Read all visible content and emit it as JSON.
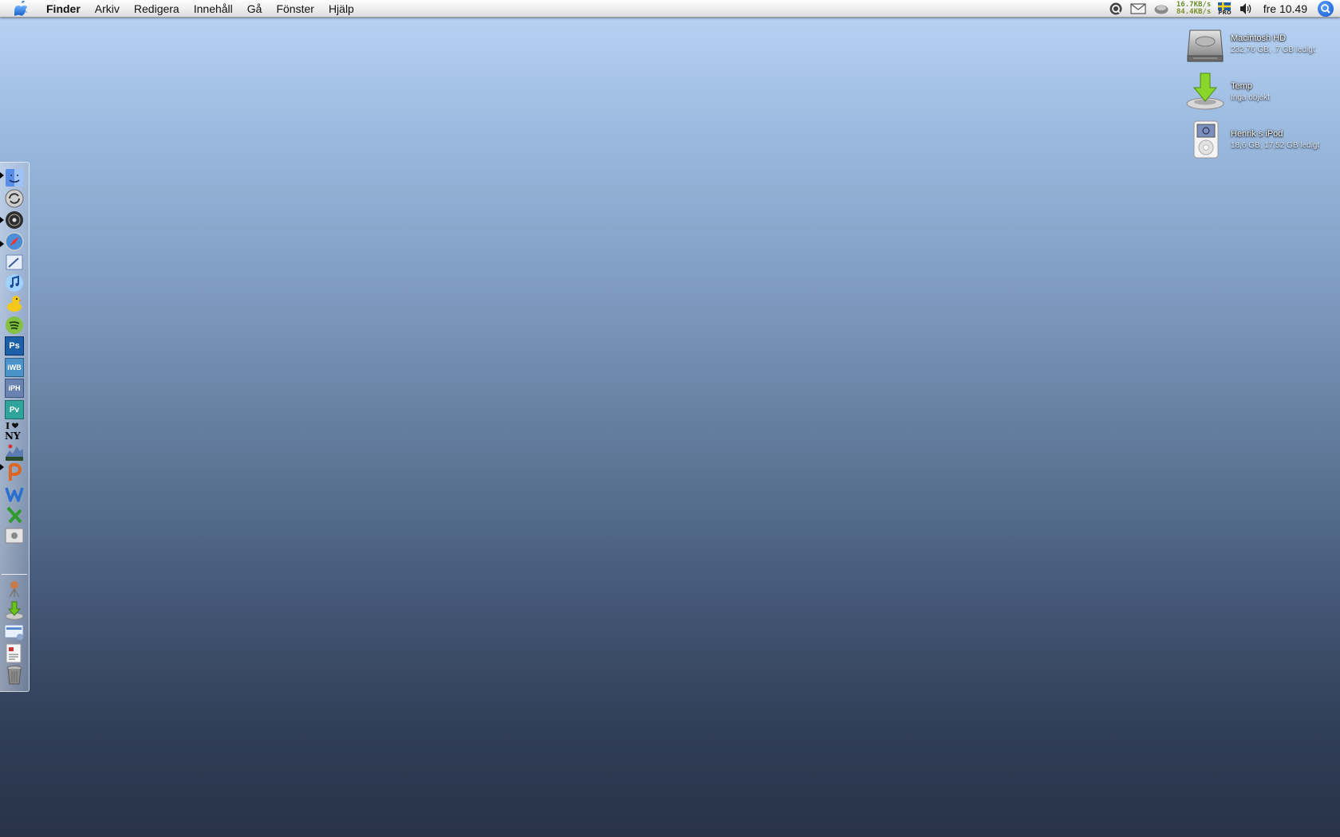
{
  "menubar": {
    "app_name": "Finder",
    "items": [
      "Arkiv",
      "Redigera",
      "Innehåll",
      "Gå",
      "Fönster",
      "Hjälp"
    ],
    "extras": {
      "net_up": "16.7KB/s",
      "net_down": "84.4KB/s",
      "flag_badge": "PRO",
      "clock": "fre 10.49"
    }
  },
  "dock": {
    "items": [
      {
        "icon": "finder-icon",
        "running": true
      },
      {
        "icon": "sync-icon",
        "running": false
      },
      {
        "icon": "cd-icon",
        "running": true
      },
      {
        "icon": "safari-icon",
        "running": true
      },
      {
        "icon": "mail-icon",
        "running": false
      },
      {
        "icon": "itunes-icon",
        "running": false
      },
      {
        "icon": "cyberduck-icon",
        "running": false
      },
      {
        "icon": "spotify-icon",
        "running": false
      },
      {
        "icon": "photoshop-icon",
        "label": "Ps",
        "color": "#1b5fa8",
        "running": false
      },
      {
        "icon": "iweb-icon",
        "label": "iWB",
        "color": "#4b92c9",
        "running": false
      },
      {
        "icon": "iphoto-icon",
        "label": "iPH",
        "color": "#6a82b0",
        "running": false
      },
      {
        "icon": "preview-icon",
        "label": "Pv",
        "color": "#30a49a",
        "running": false
      },
      {
        "icon": "i-love-ny-icon",
        "running": false
      },
      {
        "icon": "activity-monitor-icon",
        "running": true
      },
      {
        "icon": "powerpoint-icon",
        "running": false
      },
      {
        "icon": "word-icon",
        "running": false
      },
      {
        "icon": "excel-icon",
        "running": false
      },
      {
        "icon": "system-prefs-icon",
        "running": false
      }
    ],
    "stack_items": [
      {
        "icon": "network-stack-icon"
      },
      {
        "icon": "downloads-stack-icon"
      },
      {
        "icon": "documents-stack-icon"
      },
      {
        "icon": "papers-stack-icon"
      },
      {
        "icon": "trash-icon"
      }
    ]
  },
  "desktop": {
    "icons": [
      {
        "name": "Macintosh HD",
        "info": "232,76 GB, .7 GB ledigt",
        "icon": "hard-drive-icon"
      },
      {
        "name": "Temp",
        "info": "Inga objekt",
        "icon": "downloads-folder-icon"
      },
      {
        "name": "Henrik s iPod",
        "info": "18,6 GB, 17,52 GB ledigt",
        "icon": "ipod-icon"
      }
    ]
  }
}
